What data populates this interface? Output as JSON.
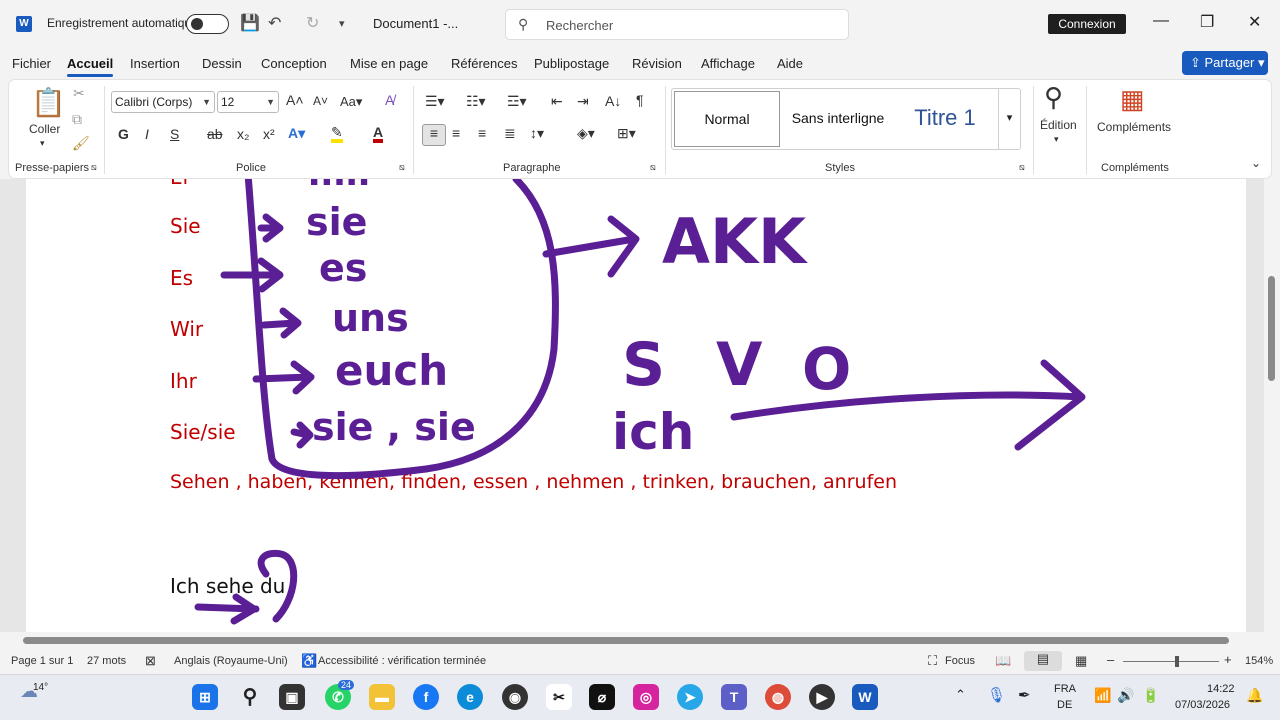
{
  "titlebar": {
    "autosave_label": "Enregistrement automatique",
    "doc_name": "Document1  -...",
    "search_placeholder": "Rechercher",
    "signin_label": "Connexion"
  },
  "menu": {
    "tabs": [
      "Fichier",
      "Accueil",
      "Insertion",
      "Dessin",
      "Conception",
      "Mise en page",
      "Références",
      "Publipostage",
      "Révision",
      "Affichage",
      "Aide"
    ],
    "active_tab": "Accueil",
    "share_label": "Partager"
  },
  "ribbon": {
    "clipboard": {
      "paste_label": "Coller",
      "group_label": "Presse-papiers"
    },
    "font": {
      "font_name": "Calibri (Corps)",
      "font_size": "12",
      "group_label": "Police",
      "bold": "G",
      "italic": "I",
      "underline": "S"
    },
    "paragraph": {
      "group_label": "Paragraphe"
    },
    "styles": {
      "items": [
        "Normal",
        "Sans interligne",
        "Titre 1"
      ],
      "group_label": "Styles"
    },
    "editing": {
      "label": "Édition"
    },
    "addins": {
      "label": "Compléments",
      "group_label": "Compléments"
    }
  },
  "document": {
    "partial_top": "Er",
    "pronoun_lines": [
      "Sie",
      "Es",
      "Wir",
      "Ihr",
      "Sie/sie"
    ],
    "verbs_line": "Sehen , haben, kennen, finden, essen , nehmen , trinken, brauchen, anrufen",
    "sentence_line": "Ich sehe du",
    "ink_words": [
      "mir",
      "sie",
      "es",
      "uns",
      "euch",
      "sie , sie",
      "AKK",
      "S",
      "V",
      "O",
      "ich"
    ]
  },
  "statusbar": {
    "page": "Page 1 sur 1",
    "words": "27 mots",
    "language": "Anglais (Royaume-Uni)",
    "accessibility": "Accessibilité : vérification terminée",
    "focus": "Focus",
    "zoom": "154%"
  },
  "taskbar": {
    "weather_temp": "14°",
    "lang_top": "FRA",
    "lang_bottom": "DE",
    "time": "14:22",
    "date": "07/03/2026",
    "whatsapp_badge": "24"
  },
  "colors": {
    "accent": "#185abd",
    "ink": "#5b1f95",
    "doc_red": "#c00000"
  }
}
